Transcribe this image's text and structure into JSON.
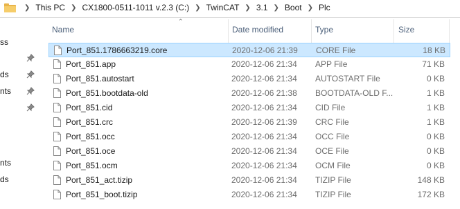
{
  "breadcrumb": {
    "items": [
      "This PC",
      "CX1800-0511-1011 v.2.3 (C:)",
      "TwinCAT",
      "3.1",
      "Boot",
      "Plc"
    ]
  },
  "nav": {
    "labels": [
      "ss",
      "ds",
      "nts",
      "nts",
      "ds"
    ]
  },
  "columns": {
    "name": "Name",
    "date": "Date modified",
    "type": "Type",
    "size": "Size"
  },
  "files": [
    {
      "name": "Port_851.1786663219.core",
      "date": "2020-12-06 21:39",
      "type": "CORE File",
      "size": "18 KB",
      "selected": true
    },
    {
      "name": "Port_851.app",
      "date": "2020-12-06 21:34",
      "type": "APP File",
      "size": "71 KB"
    },
    {
      "name": "Port_851.autostart",
      "date": "2020-12-06 21:34",
      "type": "AUTOSTART File",
      "size": "0 KB"
    },
    {
      "name": "Port_851.bootdata-old",
      "date": "2020-12-06 21:38",
      "type": "BOOTDATA-OLD F...",
      "size": "1 KB"
    },
    {
      "name": "Port_851.cid",
      "date": "2020-12-06 21:34",
      "type": "CID File",
      "size": "1 KB"
    },
    {
      "name": "Port_851.crc",
      "date": "2020-12-06 21:39",
      "type": "CRC File",
      "size": "1 KB"
    },
    {
      "name": "Port_851.occ",
      "date": "2020-12-06 21:34",
      "type": "OCC File",
      "size": "0 KB"
    },
    {
      "name": "Port_851.oce",
      "date": "2020-12-06 21:34",
      "type": "OCE File",
      "size": "0 KB"
    },
    {
      "name": "Port_851.ocm",
      "date": "2020-12-06 21:34",
      "type": "OCM File",
      "size": "0 KB"
    },
    {
      "name": "Port_851_act.tizip",
      "date": "2020-12-06 21:34",
      "type": "TIZIP File",
      "size": "148 KB"
    },
    {
      "name": "Port_851_boot.tizip",
      "date": "2020-12-06 21:34",
      "type": "TIZIP File",
      "size": "172 KB"
    }
  ]
}
